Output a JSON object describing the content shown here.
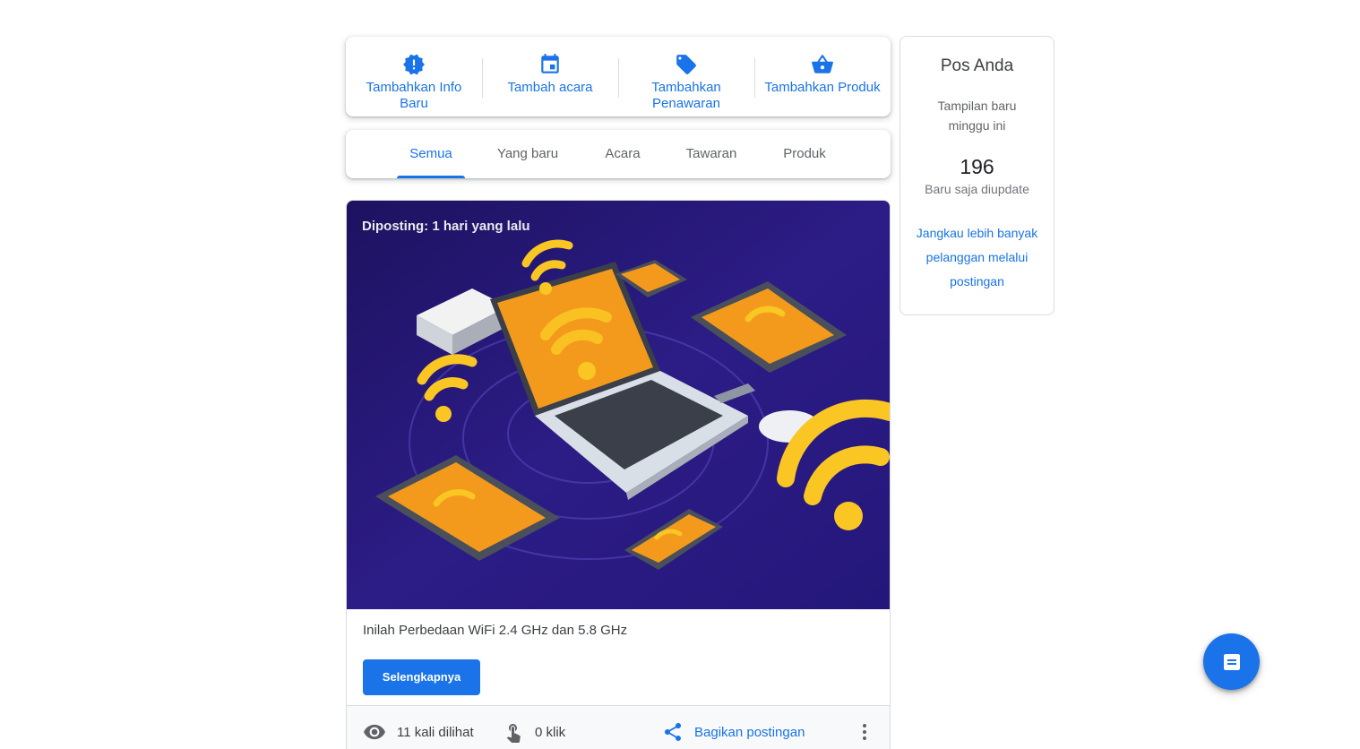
{
  "actions": [
    {
      "label": "Tambahkan Info Baru",
      "icon": "alert-badge-icon"
    },
    {
      "label": "Tambah acara",
      "icon": "calendar-icon"
    },
    {
      "label": "Tambahkan Penawaran",
      "icon": "tag-icon"
    },
    {
      "label": "Tambahkan Produk",
      "icon": "basket-icon"
    }
  ],
  "tabs": [
    {
      "label": "Semua",
      "active": true
    },
    {
      "label": "Yang baru",
      "active": false
    },
    {
      "label": "Acara",
      "active": false
    },
    {
      "label": "Tawaran",
      "active": false
    },
    {
      "label": "Produk",
      "active": false
    }
  ],
  "post": {
    "posted": "Diposting: 1 hari yang lalu",
    "title": "Inilah Perbedaan WiFi 2.4 GHz dan 5.8 GHz",
    "button_label": "Selengkapnya",
    "views": "11 kali dilihat",
    "clicks": "0 klik",
    "share_label": "Bagikan postingan"
  },
  "side": {
    "title": "Pos Anda",
    "subtitle": "Tampilan baru minggu ini",
    "count": "196",
    "updated": "Baru saja diupdate",
    "link": "Jangkau lebih banyak pelanggan melalui postingan"
  },
  "colors": {
    "accent": "#1a73e8",
    "image_bg": "#2a1a78",
    "wifi_yellow": "#f9c623",
    "screen_orange": "#f39a1c"
  }
}
